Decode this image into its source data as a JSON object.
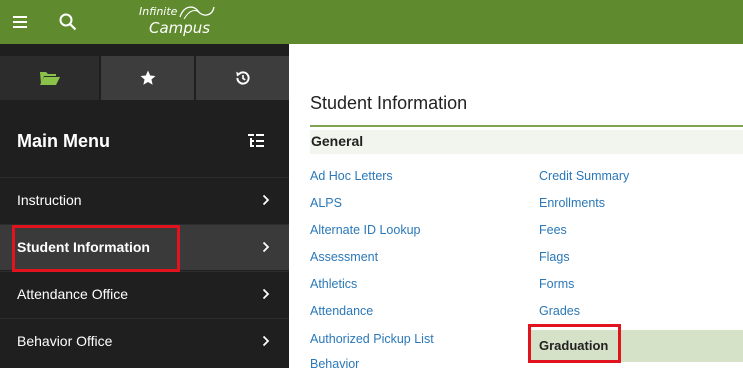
{
  "topbar": {
    "menu_icon": "hamburger-icon",
    "search_icon": "search-icon",
    "logo": {
      "line1": "Infinite",
      "line2": "Campus"
    }
  },
  "sidebar": {
    "tabs": [
      {
        "icon": "folder-open-icon"
      },
      {
        "icon": "star-icon"
      },
      {
        "icon": "history-icon"
      }
    ],
    "menu_title": "Main Menu",
    "menu_title_icon": "list-tree-icon",
    "items": [
      {
        "label": "Instruction"
      },
      {
        "label": "Student Information",
        "active": true
      },
      {
        "label": "Attendance Office"
      },
      {
        "label": "Behavior Office"
      }
    ]
  },
  "main": {
    "title": "Student Information",
    "section": "General",
    "col1_links": [
      "Ad Hoc Letters",
      "ALPS",
      "Alternate ID Lookup",
      "Assessment",
      "Athletics",
      "Attendance",
      "Authorized Pickup List",
      "Behavior"
    ],
    "col2_links": [
      "Credit Summary",
      "Enrollments",
      "Fees",
      "Flags",
      "Forms",
      "Grades"
    ],
    "selected_item": "Graduation"
  },
  "colors": {
    "topbar": "#5f8b2e",
    "sidebar": "#1f1f1f",
    "link": "#2a78b8",
    "highlight": "#e0131f",
    "selected_row": "#d6e2c8"
  }
}
